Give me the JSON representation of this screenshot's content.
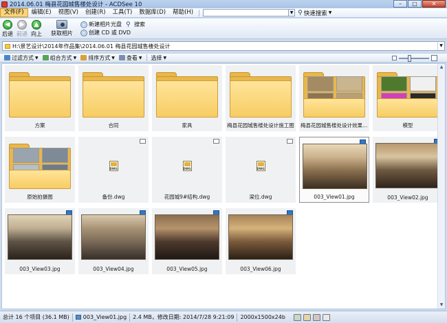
{
  "window": {
    "title": "2014.06.01 梅县花园城售楼处设计 - ACDSee 10",
    "controls": {
      "minimize": "–",
      "maximize": "□",
      "close": "✕"
    }
  },
  "menu": {
    "items": [
      "文件(F)",
      "编辑(E)",
      "视图(V)",
      "创建(R)",
      "工具(T)",
      "数据库(D)",
      "帮助(H)"
    ],
    "quick_search": "快速搜索"
  },
  "toolbar": {
    "back": "后退",
    "forward": "前进",
    "up": "向上",
    "acquire": "获取相片",
    "create_disc": "新建相片光盘",
    "create_cd": "创建 CD 或 DVD",
    "search": "搜索"
  },
  "address": {
    "path": "H:\\景艺设计\\2014年作品集\\2014.06.01 梅县花园城售楼处设计"
  },
  "viewbar": {
    "filter": "过滤方式",
    "group": "组合方式",
    "sort": "排序方式",
    "view": "查看",
    "select": "选择"
  },
  "files": [
    {
      "name": "方案",
      "kind": "folder"
    },
    {
      "name": "合同",
      "kind": "folder"
    },
    {
      "name": "家具",
      "kind": "folder"
    },
    {
      "name": "梅县花园城售楼处设计施工图",
      "kind": "folder"
    },
    {
      "name": "梅县花园城售楼处设计效果图（...",
      "kind": "folder-photos"
    },
    {
      "name": "模型",
      "kind": "folder-textures"
    },
    {
      "name": "原始拍摄图",
      "kind": "folder-photos2"
    },
    {
      "name": "备份.dwg",
      "kind": "dwg"
    },
    {
      "name": "花园城9#结构.dwg",
      "kind": "dwg"
    },
    {
      "name": "梁位.dwg",
      "kind": "dwg"
    },
    {
      "name": "003_View01.jpg",
      "kind": "jpg",
      "selected": true
    },
    {
      "name": "003_View02.jpg",
      "kind": "jpg"
    },
    {
      "name": "003_View03.jpg",
      "kind": "jpg"
    },
    {
      "name": "003_View04.jpg",
      "kind": "jpg"
    },
    {
      "name": "003_View05.jpg",
      "kind": "jpg"
    },
    {
      "name": "003_View06.jpg",
      "kind": "jpg"
    }
  ],
  "status": {
    "total": "总计 16 个项目 (36.1 MB)",
    "file": "003_View01.jpg",
    "info": "2.4 MB，修改日期: 2014/7/28 9:21:09",
    "dims": "2000x1500x24b"
  }
}
